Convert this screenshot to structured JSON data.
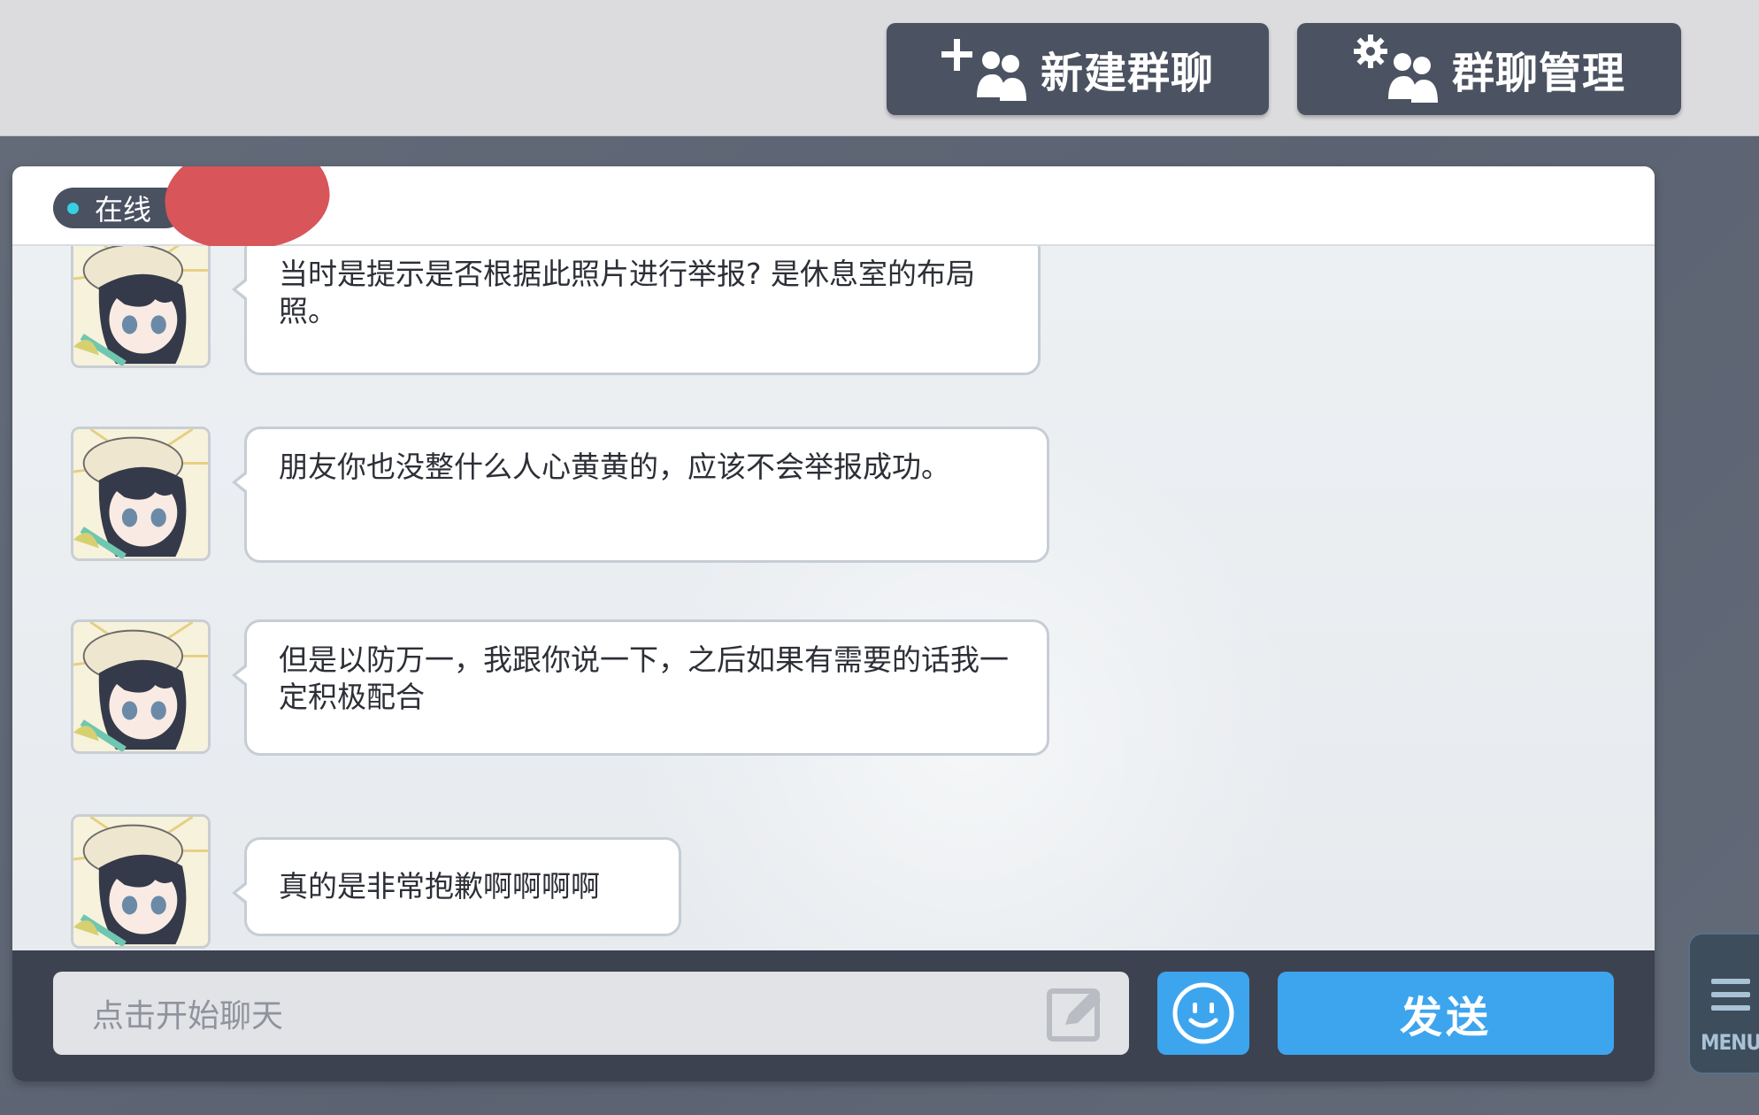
{
  "toolbar": {
    "new_group_label": "新建群聊",
    "manage_group_label": "群聊管理"
  },
  "chat": {
    "status": "在线",
    "messages": [
      {
        "text": "当时是提示是否根据此照片进行举报? 是休息室的布局照。"
      },
      {
        "text": "朋友你也没整什么人心黄黄的，应该不会举报成功。"
      },
      {
        "text": "但是以防万一，我跟你说一下，之后如果有需要的话我一定积极配合"
      },
      {
        "text": "真的是非常抱歉啊啊啊啊"
      }
    ]
  },
  "composer": {
    "placeholder": "点击开始聊天",
    "send_label": "发送"
  },
  "menu": {
    "label": "MENU"
  },
  "colors": {
    "accent": "#3da5ee",
    "dark_button": "#4b5261",
    "online_dot": "#36d0e2",
    "redaction": "#d85559"
  }
}
